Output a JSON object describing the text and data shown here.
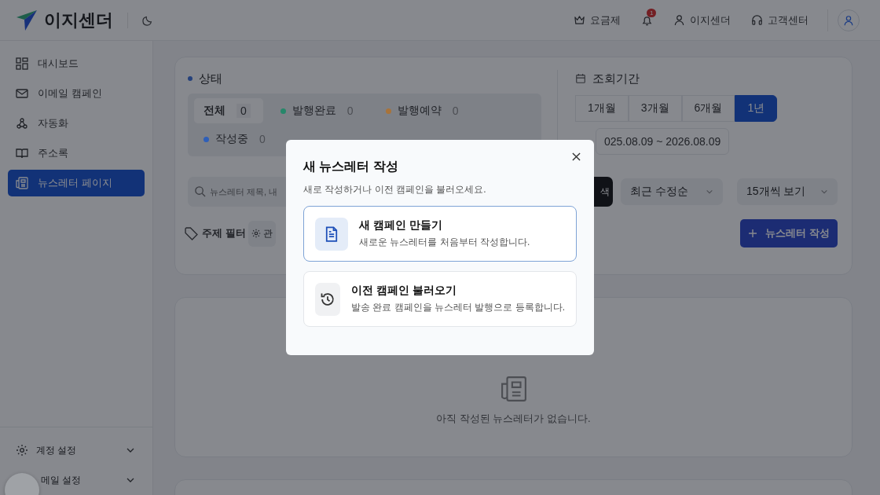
{
  "header": {
    "logo": "이지센더",
    "nav": [
      {
        "kind": "crown",
        "label": "요금제"
      },
      {
        "kind": "bell",
        "badge": "1"
      },
      {
        "kind": "user",
        "label": "이지센더"
      },
      {
        "kind": "headset",
        "label": "고객센터"
      }
    ]
  },
  "sidebar": {
    "items": [
      {
        "kind": "grid",
        "label": "대시보드",
        "selected": false
      },
      {
        "kind": "mail",
        "label": "이메일 캠페인",
        "selected": false
      },
      {
        "kind": "flow",
        "label": "자동화",
        "selected": false
      },
      {
        "kind": "book",
        "label": "주소록",
        "selected": false
      },
      {
        "kind": "news",
        "label": "뉴스레터 페이지",
        "selected": true
      }
    ],
    "bottom": [
      {
        "kind": "gear",
        "label": "계정 설정"
      },
      {
        "kind": "none",
        "label": "메일 설정"
      }
    ]
  },
  "status": {
    "title": "상태",
    "tabs": [
      {
        "label": "전체",
        "count": "0",
        "selected": true
      },
      {
        "label": "발행완료",
        "count": "0",
        "color": "#26876a",
        "selected": false
      },
      {
        "label": "발행예약",
        "count": "0",
        "color": "#a8733a",
        "selected": false
      },
      {
        "label": "작성중",
        "count": "0",
        "color": "#2f5fb8",
        "selected": false
      }
    ]
  },
  "period": {
    "title": "조회기간",
    "options": [
      {
        "label": "1개월",
        "selected": false
      },
      {
        "label": "3개월",
        "selected": false
      },
      {
        "label": "6개월",
        "selected": false
      },
      {
        "label": "1년",
        "selected": true
      }
    ],
    "range": "025.08.09 ~ 2026.08.09"
  },
  "search": {
    "placeholder": "뉴스레터 제목, 내",
    "button": "색"
  },
  "sort": "최근 수정순",
  "per_page": "15개씩 보기",
  "topic_filter": {
    "label": "주제 필터",
    "chip": "관"
  },
  "create_button": "뉴스레터 작성",
  "empty_text": "아직 작성된 뉴스레터가 없습니다.",
  "modal": {
    "title": "새 뉴스레터 작성",
    "subtitle": "새로 작성하거나 이전 캠페인을 불러오세요.",
    "options": [
      {
        "kind": "new",
        "title": "새 캠페인 만들기",
        "description": "새로운 뉴스레터를 처음부터 작성합니다.",
        "selected": true
      },
      {
        "kind": "history",
        "title": "이전 캠페인 불러오기",
        "description": "발송 완료 캠페인을 뉴스레터 발행으로 등록합니다.",
        "selected": false
      }
    ]
  }
}
